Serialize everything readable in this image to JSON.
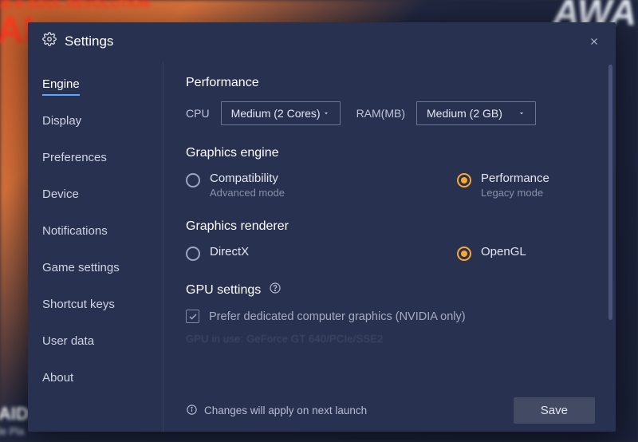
{
  "header": {
    "title": "Settings"
  },
  "sidebar": {
    "items": [
      {
        "label": "Engine",
        "active": true
      },
      {
        "label": "Display"
      },
      {
        "label": "Preferences"
      },
      {
        "label": "Device"
      },
      {
        "label": "Notifications"
      },
      {
        "label": "Game settings"
      },
      {
        "label": "Shortcut keys"
      },
      {
        "label": "User data"
      },
      {
        "label": "About"
      }
    ]
  },
  "performance": {
    "title": "Performance",
    "cpu_label": "CPU",
    "cpu_value": "Medium (2 Cores)",
    "ram_label": "RAM(MB)",
    "ram_value": "Medium (2 GB)"
  },
  "graphics_engine": {
    "title": "Graphics engine",
    "options": [
      {
        "label": "Compatibility",
        "sub": "Advanced mode",
        "selected": false
      },
      {
        "label": "Performance",
        "sub": "Legacy mode",
        "selected": true
      }
    ]
  },
  "graphics_renderer": {
    "title": "Graphics renderer",
    "options": [
      {
        "label": "DirectX",
        "selected": false
      },
      {
        "label": "OpenGL",
        "selected": true
      }
    ]
  },
  "gpu": {
    "title": "GPU settings",
    "checkbox_label": "Prefer dedicated computer graphics (NVIDIA only)",
    "checkbox_checked": true,
    "in_use": "GPU in use: GeForce GT 640/PCIe/SSE2"
  },
  "footer": {
    "note": "Changes will apply on next launch",
    "save": "Save"
  },
  "bg": {
    "text1": "DE & SOUL REVOLUTION",
    "text2": "AI",
    "text3": "AWA",
    "text4": "AID: S",
    "text5": "le Pla"
  }
}
